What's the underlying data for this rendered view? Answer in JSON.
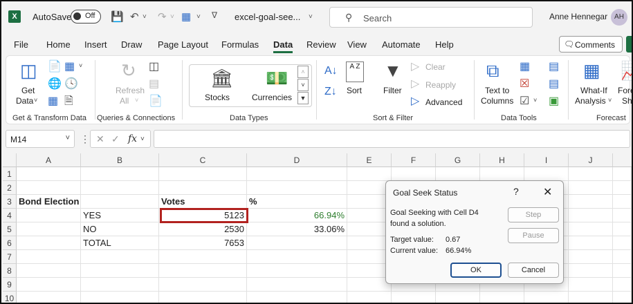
{
  "titlebar": {
    "app_icon": "X",
    "autosave_label": "AutoSave",
    "autosave_state": "Off",
    "document_title": "excel-goal-see...",
    "search_placeholder": "Search",
    "user_name": "Anne Hennegar",
    "user_initials": "AH"
  },
  "menu": {
    "tabs": [
      "File",
      "Home",
      "Insert",
      "Draw",
      "Page Layout",
      "Formulas",
      "Data",
      "Review",
      "View",
      "Automate",
      "Help"
    ],
    "active_tab": "Data",
    "comments_label": "Comments",
    "accent_color": "#1d6f42"
  },
  "ribbon": {
    "get_data": {
      "line1": "Get",
      "line2": "Data"
    },
    "refresh_all": {
      "line1": "Refresh",
      "line2": "All"
    },
    "stocks": "Stocks",
    "currencies": "Currencies",
    "sort_az": "A Z",
    "sort": "Sort",
    "filter": "Filter",
    "clear": "Clear",
    "reapply": "Reapply",
    "advanced": "Advanced",
    "text_to_columns": {
      "line1": "Text to",
      "line2": "Columns"
    },
    "whatif": {
      "line1": "What-If",
      "line2": "Analysis"
    },
    "forecast_cut": {
      "line1": "Fore",
      "line2": "Sh"
    },
    "groups": [
      "Get & Transform Data",
      "Queries & Connections",
      "Data Types",
      "Sort & Filter",
      "Data Tools",
      "Forecast"
    ]
  },
  "formula_bar": {
    "name_box": "M14",
    "fx": "fx",
    "value": ""
  },
  "sheet": {
    "columns": [
      "A",
      "B",
      "C",
      "D",
      "E",
      "F",
      "G",
      "H",
      "I",
      "J"
    ],
    "rows": [
      "1",
      "2",
      "3",
      "4",
      "5",
      "6",
      "7",
      "8",
      "9",
      "10"
    ],
    "cells": {
      "A3": "Bond Election",
      "C3": "Votes",
      "D3": "%",
      "B4": "YES",
      "C4": "5123",
      "D4": "66.94%",
      "B5": "NO",
      "C5": "2530",
      "D5": "33.06%",
      "B6": "TOTAL",
      "C6": "7653"
    },
    "highlight_color": "#b2221f"
  },
  "dialog": {
    "title": "Goal Seek Status",
    "help": "?",
    "close": "✕",
    "message_line1": "Goal Seeking with Cell D4",
    "message_line2": "found a solution.",
    "target_label": "Target value:",
    "target_value": "0.67",
    "current_label": "Current value:",
    "current_value": "66.94%",
    "step": "Step",
    "pause": "Pause",
    "ok": "OK",
    "cancel": "Cancel"
  }
}
